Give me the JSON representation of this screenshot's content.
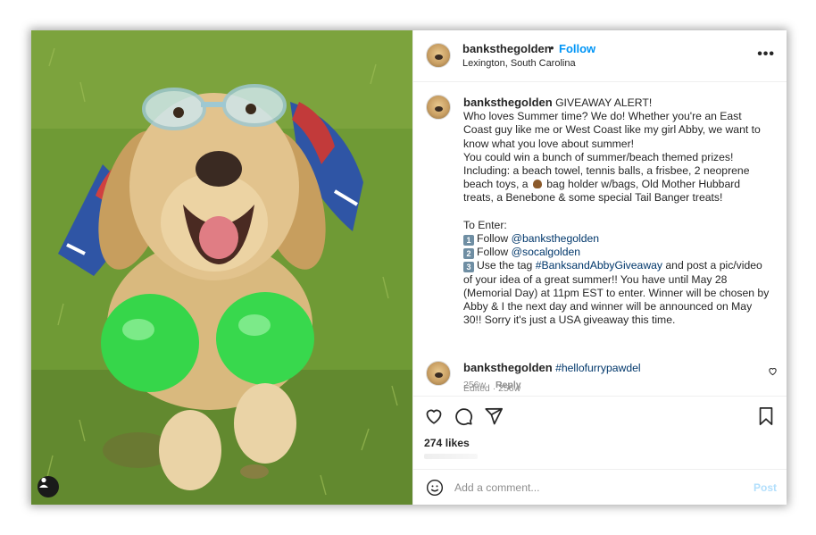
{
  "post": {
    "username": "banksthegolden",
    "separator": "•",
    "follow_label": "Follow",
    "location": "Lexington, South Carolina",
    "more_label": "•••"
  },
  "caption": {
    "username": "banksthegolden",
    "lines": [
      "GIVEAWAY ALERT!",
      "Who loves Summer time? We do! Whether you're an East",
      "Coast guy like me or West Coast like my girl Abby, we want to",
      "know what you love about summer!",
      "You could win a bunch of summer/beach themed prizes!",
      "Including: a beach towel, tennis balls, a frisbee, 2 neoprene"
    ],
    "line7_a": "beach toys, a",
    "line7_b": "bag holder w/bags, Old Mother Hubbard",
    "line8": "treats, a Benebone & some special Tail Banger treats!",
    "to_enter": "To Enter:",
    "step1_num": "1",
    "step1_text": "Follow",
    "step1_mention": "@banksthegolden",
    "step2_num": "2",
    "step2_text": "Follow",
    "step2_mention": "@socalgolden",
    "step3_num": "3",
    "step3_text": "Use the tag",
    "step3_tag": "#BanksandAbbyGiveaway",
    "step3_rest": "and post a pic/video",
    "tail_lines": [
      "of your idea of a great summer!! You have until May 28",
      "(Memorial Day) at 11pm EST to enter. Winner will be chosen by",
      "Abby & I the next day and winner will be announced on May",
      "30!! Sorry it's just a USA giveaway this time."
    ],
    "meta": "Edited · 256w"
  },
  "comment": {
    "username": "banksthegolden",
    "hashtag": "#hellofurrypawdel",
    "age": "256w",
    "reply_label": "Reply"
  },
  "likes": "274 likes",
  "add_comment": {
    "placeholder": "Add a comment...",
    "post_label": "Post"
  },
  "icons": [
    "heart-icon",
    "comment-icon",
    "share-icon",
    "bookmark-icon",
    "smiley-icon",
    "user-tag-icon",
    "more-options-icon"
  ],
  "colors": {
    "link": "#0095f6",
    "mention": "#00376b",
    "post_disabled": "#b2dffc",
    "muted": "#8e8e8e"
  }
}
